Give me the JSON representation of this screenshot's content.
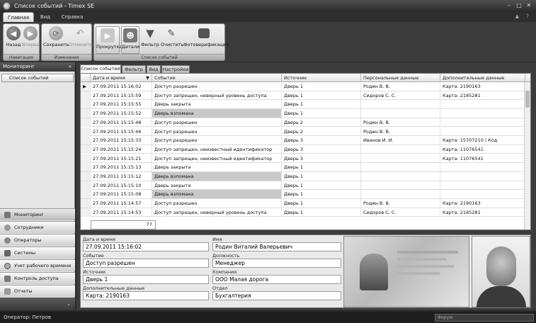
{
  "window": {
    "title": "Список событий - Timex SE"
  },
  "ribbon_tabs": [
    "Главная",
    "Вид",
    "Справка"
  ],
  "ribbon": {
    "navigation": {
      "caption": "Навигация",
      "back": "Назад",
      "forward": "Вперед"
    },
    "changes": {
      "caption": "Изменения",
      "save": "Сохранить",
      "cancel": "Отменить"
    },
    "event_list": {
      "caption": "Список событий",
      "scroll": "Прокрутка",
      "details": "Детали",
      "filter": "Фильтр",
      "clear": "Очистить",
      "photo": "Фотоверификация"
    }
  },
  "sidebar": {
    "header": "Мониторинг",
    "collapse": "«",
    "item": "Список событий",
    "nav": [
      "Мониторинг",
      "Сотрудники",
      "Операторы",
      "Системы",
      "Учет рабочего времени",
      "Контроль доступа",
      "Отчеты"
    ]
  },
  "content_tabs": [
    "Список событий",
    "Фильтр",
    "Вид",
    "Настройки"
  ],
  "grid": {
    "columns": [
      "Дата и время",
      "Событие",
      "Источник",
      "Персональные данные",
      "Дополнительные данные"
    ],
    "rows": [
      {
        "date": "27.09.2011 15:16:02",
        "event": "Доступ разрешен",
        "source": "Дверь 1",
        "person": "Родин В. В.",
        "extra": "Карта: 2190163",
        "alarm": false
      },
      {
        "date": "27.09.2011 15:15:59",
        "event": "Доступ запрещен, неверный уровень доступа",
        "source": "Дверь 1",
        "person": "Сидоров С. С.",
        "extra": "Карта: 2185281",
        "alarm": false
      },
      {
        "date": "27.09.2011 15:15:55",
        "event": "Дверь закрыта",
        "source": "Дверь 1",
        "person": "",
        "extra": "",
        "alarm": false
      },
      {
        "date": "27.09.2011 15:15:52",
        "event": "Дверь взломана",
        "source": "Дверь 1",
        "person": "",
        "extra": "",
        "alarm": true
      },
      {
        "date": "27.09.2011 15:15:48",
        "event": "Доступ разрешен",
        "source": "Дверь 2",
        "person": "Родин В. В.",
        "extra": "",
        "alarm": false
      },
      {
        "date": "27.09.2011 15:15:46",
        "event": "Доступ разрешен",
        "source": "Дверь 2",
        "person": "Родин В. В.",
        "extra": "",
        "alarm": false
      },
      {
        "date": "27.09.2011 15:15:33",
        "event": "Доступ разрешен",
        "source": "Дверь 3",
        "person": "Иванов И. И.",
        "extra": "Карта: 15707210 | Код",
        "alarm": false
      },
      {
        "date": "27.09.2011 15:15:24",
        "event": "Доступ запрещен, неизвестный идентификатор",
        "source": "Дверь 3",
        "person": "",
        "extra": "Карта: 11076541",
        "alarm": false
      },
      {
        "date": "27.09.2011 15:15:21",
        "event": "Доступ запрещен, неизвестный идентификатор",
        "source": "Дверь 3",
        "person": "",
        "extra": "Карта: 11076541",
        "alarm": false
      },
      {
        "date": "27.09.2011 15:15:13",
        "event": "Дверь закрыта",
        "source": "Дверь 1",
        "person": "",
        "extra": "",
        "alarm": false
      },
      {
        "date": "27.09.2011 15:15:12",
        "event": "Дверь взломана",
        "source": "Дверь 1",
        "person": "",
        "extra": "",
        "alarm": true
      },
      {
        "date": "27.09.2011 15:15:10",
        "event": "Дверь закрыта",
        "source": "Дверь 1",
        "person": "",
        "extra": "",
        "alarm": false
      },
      {
        "date": "27.09.2011 15:15:08",
        "event": "Дверь взломана",
        "source": "Дверь 1",
        "person": "",
        "extra": "",
        "alarm": true
      },
      {
        "date": "27.09.2011 15:14:57",
        "event": "Доступ разрешен",
        "source": "Дверь 1",
        "person": "Родин В. В.",
        "extra": "Карта: 2190163",
        "alarm": false
      },
      {
        "date": "27.09.2011 15:14:53",
        "event": "Доступ запрещен, неверный уровень доступа",
        "source": "Дверь 1",
        "person": "Сидоров С. С.",
        "extra": "Карта: 2185281",
        "alarm": false
      }
    ],
    "count": "77"
  },
  "details": {
    "labels": {
      "datetime": "Дата и время",
      "event": "Событие",
      "source": "Источник",
      "extra": "Дополнительные данные",
      "name": "Имя",
      "position": "Должность",
      "company": "Компания",
      "department": "Отдел"
    },
    "values": {
      "datetime": "27.09.2011 15:16:02",
      "event": "Доступ разрешен",
      "source": "Дверь 1",
      "extra": "Карта: 2190163",
      "name": "Родин Виталий Валерьевич",
      "position": "Менеджер",
      "company": "ООО Малая дорога",
      "department": "Бухгалтерия"
    }
  },
  "status": {
    "operator": "Оператор: Петров",
    "forum": "Форум:"
  }
}
